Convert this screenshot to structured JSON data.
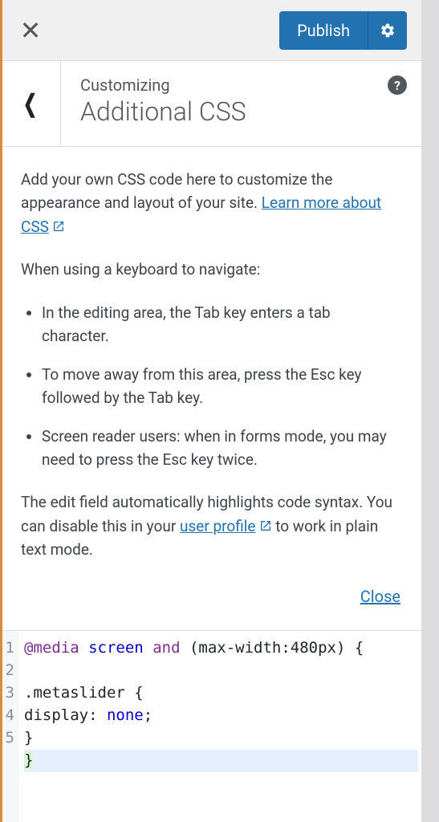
{
  "topbar": {
    "publish_label": "Publish"
  },
  "header": {
    "customizing_label": "Customizing",
    "section_title": "Additional CSS"
  },
  "description": {
    "intro_prefix": "Add your own CSS code here to customize the appearance and layout of your site. ",
    "learn_more_link": "Learn more about CSS",
    "keyboard_intro": "When using a keyboard to navigate:",
    "bullet1": "In the editing area, the Tab key enters a tab character.",
    "bullet2": "To move away from this area, press the Esc key followed by the Tab key.",
    "bullet3": "Screen reader users: when in forms mode, you may need to press the Esc key twice.",
    "edit_field_prefix": "The edit field automatically highlights code syntax. You can disable this in your ",
    "user_profile_link": "user profile",
    "edit_field_suffix": " to work in plain text mode.",
    "close_label": "Close"
  },
  "code": {
    "lines": [
      {
        "n": "1",
        "tokens": [
          {
            "t": "@media",
            "cls": "tok-atrule"
          },
          {
            "t": " ",
            "cls": ""
          },
          {
            "t": "screen",
            "cls": "tok-attr"
          },
          {
            "t": " ",
            "cls": ""
          },
          {
            "t": "and",
            "cls": "tok-kw"
          },
          {
            "t": " (max-width:480px) {",
            "cls": "tok-punc"
          }
        ]
      },
      {
        "n": "2",
        "tokens": [
          {
            "t": ".metaslider {",
            "cls": "tok-sel"
          }
        ]
      },
      {
        "n": "3",
        "tokens": [
          {
            "t": "display",
            "cls": "tok-prop"
          },
          {
            "t": ": ",
            "cls": "tok-punc"
          },
          {
            "t": "none",
            "cls": "tok-attr"
          },
          {
            "t": ";",
            "cls": "tok-punc"
          }
        ]
      },
      {
        "n": "4",
        "tokens": [
          {
            "t": "}",
            "cls": "tok-punc"
          }
        ]
      },
      {
        "n": "5",
        "tokens": [
          {
            "t": "}",
            "cls": "tok-punc active-line-bracket"
          }
        ]
      }
    ]
  }
}
